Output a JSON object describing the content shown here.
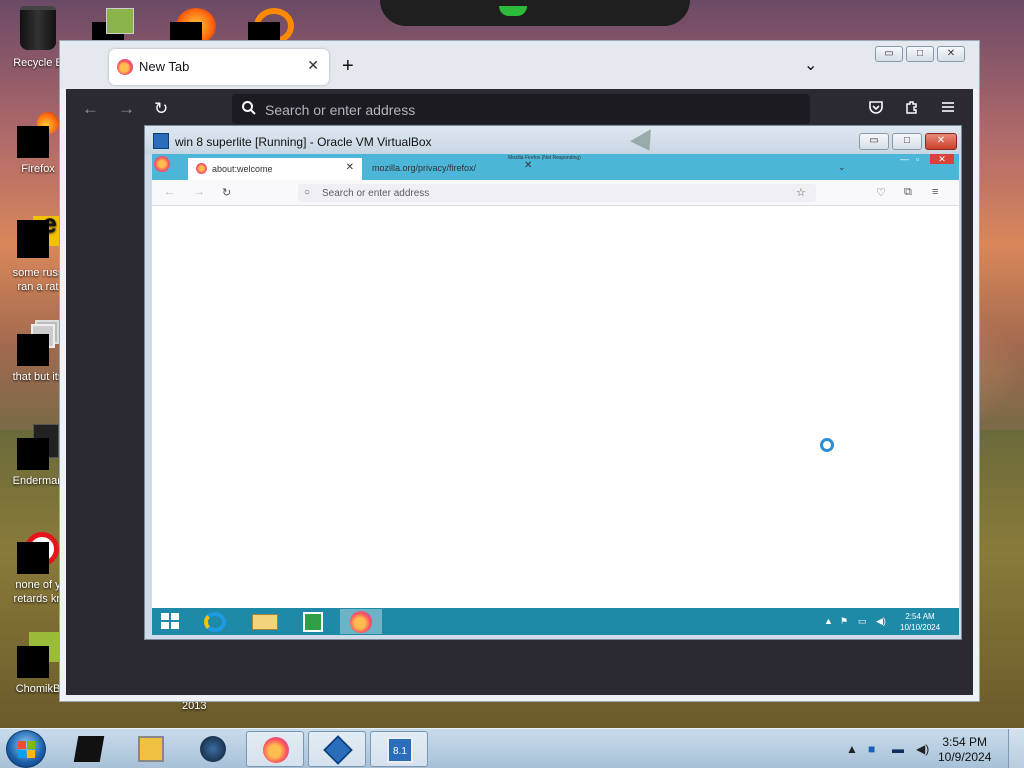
{
  "desktop": {
    "icons": [
      {
        "label_1": "Recycle B",
        "label_2": ""
      },
      {
        "label_1": "Firefox",
        "label_2": ""
      },
      {
        "label_1": "some russ",
        "label_2": "ran a rat"
      },
      {
        "label_1": "that but its",
        "label_2": ""
      },
      {
        "label_1": "Enderman",
        "label_2": ""
      },
      {
        "label_1": "none of y",
        "label_2": "retards kn"
      },
      {
        "label_1": "ChomikB",
        "label_2": ""
      }
    ],
    "partial_label": "2013"
  },
  "firefox": {
    "tab_title": "New Tab",
    "tab_close": "✕",
    "new_tab": "+",
    "list_tabs": "⌄",
    "window_buttons": [
      "▭",
      "□",
      "✕"
    ],
    "nav": {
      "back": "←",
      "forward": "→",
      "reload": "↻"
    },
    "url_placeholder": "Search or enter address",
    "right_icons": [
      "pocket-icon",
      "extensions-icon",
      "menu-icon"
    ]
  },
  "virtualbox": {
    "title": "win 8 superlite [Running] - Oracle VM VirtualBox",
    "window_buttons": [
      "▭",
      "□",
      "✕"
    ],
    "guest": {
      "tab1_title": "about:welcome",
      "tab1_close": "✕",
      "tab2_title": "mozilla.org/privacy/firefox/",
      "tab2_close": "✕",
      "tab3_title": "Mozilla Firefox (Not Responding)",
      "url_placeholder": "Search or enter address",
      "time": "2:54 AM",
      "date": "10/10/2024"
    }
  },
  "taskbar": {
    "time": "3:54 PM",
    "date": "10/9/2024",
    "vbox_badge": "8.1"
  },
  "colors": {
    "firefox_dark": "#2b2a33",
    "guest_accent": "#4bb6d8",
    "guest_taskbar": "#1f8aa8"
  }
}
